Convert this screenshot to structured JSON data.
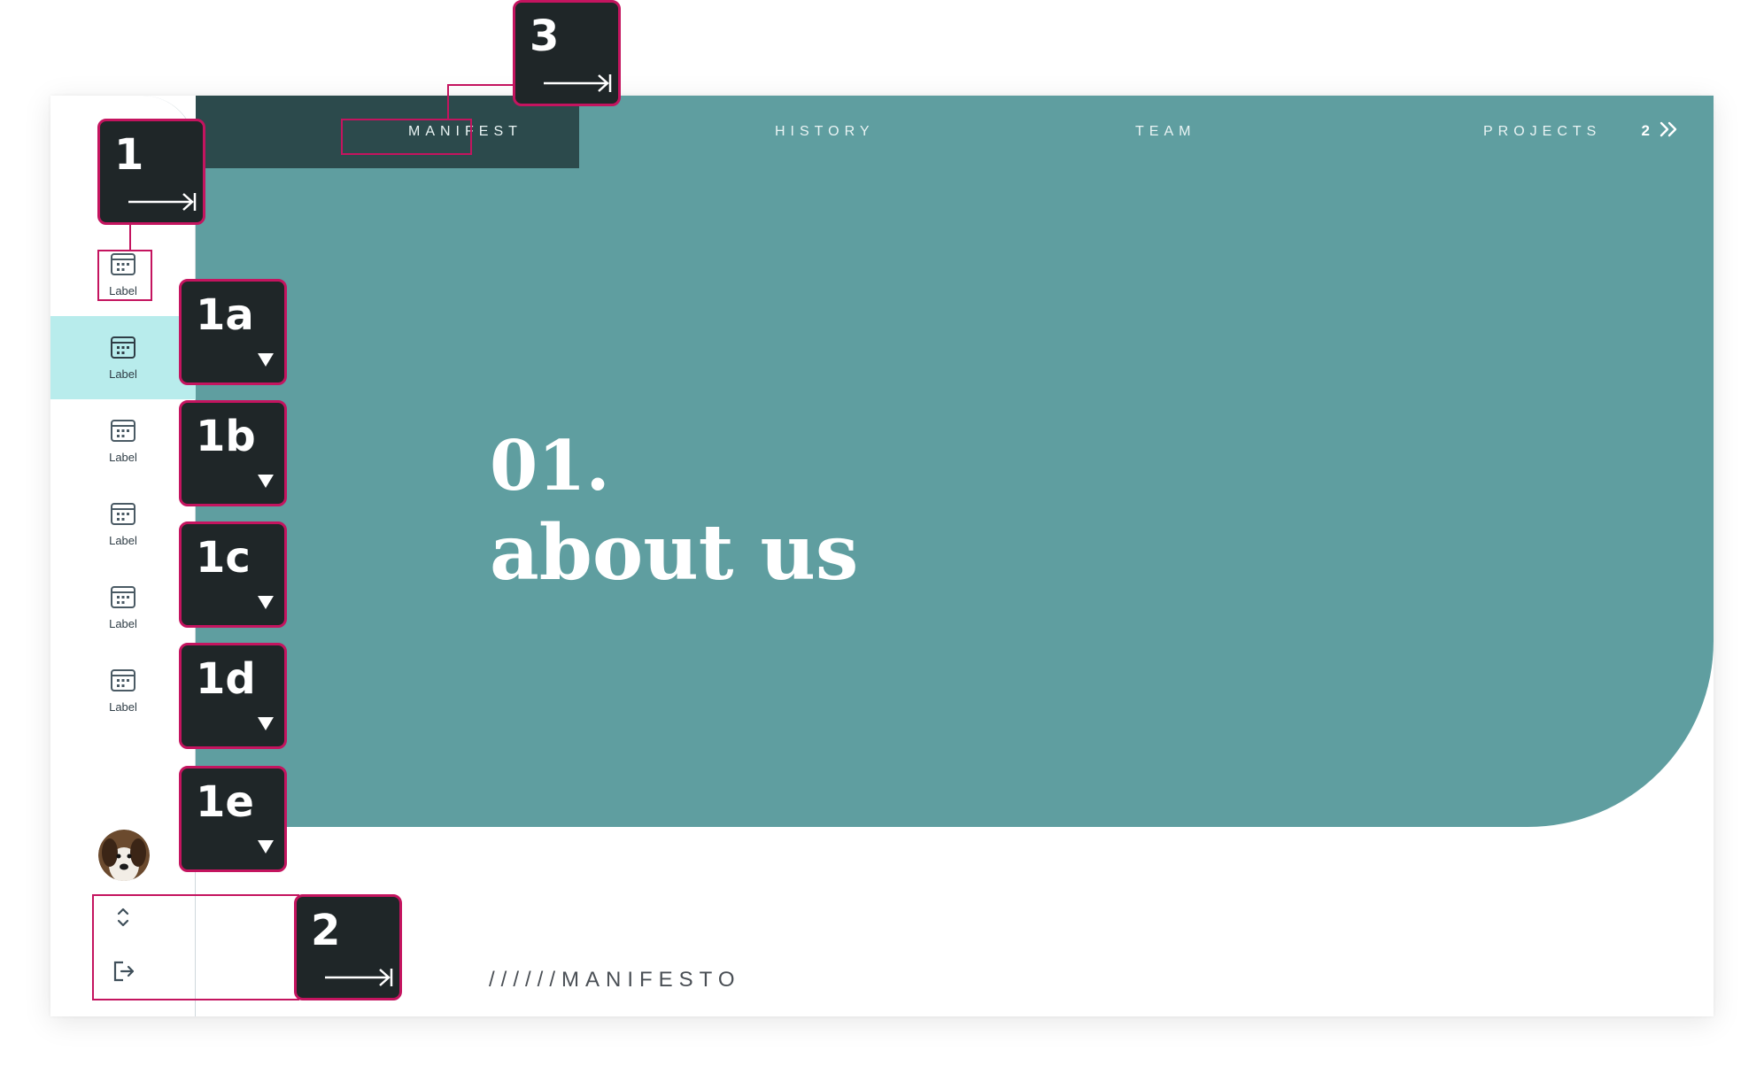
{
  "nav": {
    "tabs": [
      {
        "label": "MANIFEST",
        "active": true
      },
      {
        "label": "HISTORY",
        "active": false
      },
      {
        "label": "TEAM",
        "active": false
      },
      {
        "label": "PROJECTS",
        "active": false
      }
    ],
    "page_number": "2",
    "next_icon": "double-chevron-right-icon"
  },
  "sidebar": {
    "items": [
      {
        "label": "Label",
        "icon": "calendar-icon",
        "active": false
      },
      {
        "label": "Label",
        "icon": "calendar-icon",
        "active": true
      },
      {
        "label": "Label",
        "icon": "calendar-icon",
        "active": false
      },
      {
        "label": "Label",
        "icon": "calendar-icon",
        "active": false
      },
      {
        "label": "Label",
        "icon": "calendar-icon",
        "active": false
      },
      {
        "label": "Label",
        "icon": "calendar-icon",
        "active": false
      }
    ],
    "avatar_icon": "user-avatar",
    "expand_icon": "unfold-icon",
    "logout_icon": "logout-icon"
  },
  "hero": {
    "number": "01.",
    "heading": "about us"
  },
  "footer": {
    "text": "//////MANIFESTO"
  },
  "annotations": {
    "badge_1": "1",
    "badge_1a": "1a",
    "badge_1b": "1b",
    "badge_1c": "1c",
    "badge_1d": "1d",
    "badge_1e": "1e",
    "badge_2": "2",
    "badge_3": "3"
  },
  "colors": {
    "hero": "#5f9ea0",
    "active_tab": "#2c4a4c",
    "active_sidebar": "#b8ecec",
    "annotation_border": "#c4145f",
    "annotation_fill": "#1f2628"
  }
}
